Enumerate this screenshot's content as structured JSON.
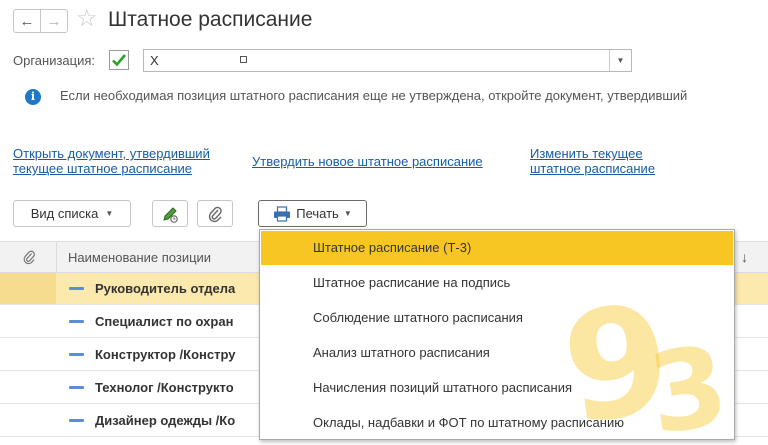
{
  "header": {
    "title": "Штатное расписание",
    "back_icon": "arrow-left-icon",
    "forward_icon": "arrow-right-icon",
    "favorite_icon": "star-icon"
  },
  "organization": {
    "label": "Организация:",
    "checked": true,
    "value": "X"
  },
  "info": {
    "icon": "info-icon",
    "text": "Если необходимая позиция штатного расписания еще не утверждена, откройте документ, утвердивший"
  },
  "links": {
    "open_document": "Открыть документ, утвердивший текущее штатное расписание",
    "approve_new": "Утвердить новое штатное расписание",
    "change_current": "Изменить текущее штатное расписание"
  },
  "toolbar": {
    "view_list_label": "Вид списка",
    "print_label": "Печать",
    "pen_icon": "edit-pen-icon",
    "clip_icon": "paperclip-icon",
    "print_icon": "printer-icon"
  },
  "grid": {
    "header_name": "Наименование позиции",
    "sort_indicator": "↓",
    "rows": [
      "Руководитель отдела",
      "Специалист по охран",
      "Конструктор /Констру",
      "Технолог /Конструкто",
      "Дизайнер одежды /Ко"
    ]
  },
  "print_menu": {
    "items": [
      "Штатное расписание (Т-3)",
      "Штатное расписание на подпись",
      "Соблюдение штатного расписания",
      "Анализ штатного расписания",
      "Начисления позиций штатного расписания",
      "Оклады, надбавки и ФОТ по штатному расписанию"
    ],
    "active_index": 0
  },
  "watermark": {
    "text_9": "9",
    "text_3": "3",
    "color": "#f7c623"
  },
  "colors": {
    "accent": "#f7c623",
    "link": "#1c5aa6",
    "selected_row": "#fbe9ae",
    "info": "#1f78c4",
    "check": "#2aa12a"
  }
}
